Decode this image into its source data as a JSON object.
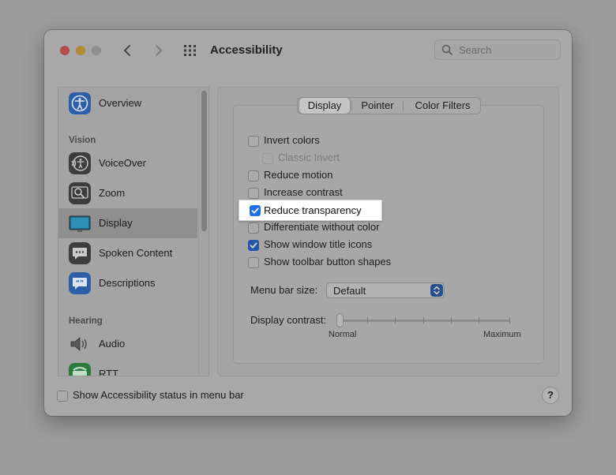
{
  "window": {
    "title": "Accessibility",
    "search_placeholder": "Search"
  },
  "sidebar": {
    "items": [
      {
        "label": "Overview",
        "icon": "overview-icon"
      },
      {
        "label": "VoiceOver",
        "icon": "voiceover-icon"
      },
      {
        "label": "Zoom",
        "icon": "zoom-icon"
      },
      {
        "label": "Display",
        "icon": "display-icon",
        "selected": true
      },
      {
        "label": "Spoken Content",
        "icon": "spoken-content-icon"
      },
      {
        "label": "Descriptions",
        "icon": "descriptions-icon"
      },
      {
        "label": "Audio",
        "icon": "audio-icon"
      },
      {
        "label": "RTT",
        "icon": "rtt-icon"
      }
    ],
    "sections": {
      "vision": "Vision",
      "hearing": "Hearing"
    }
  },
  "tabs": [
    {
      "label": "Display",
      "active": true
    },
    {
      "label": "Pointer",
      "active": false
    },
    {
      "label": "Color Filters",
      "active": false
    }
  ],
  "options": [
    {
      "label": "Invert colors",
      "checked": false,
      "disabled": false
    },
    {
      "label": "Classic Invert",
      "checked": false,
      "disabled": true
    },
    {
      "label": "Reduce motion",
      "checked": false,
      "disabled": false
    },
    {
      "label": "Increase contrast",
      "checked": false,
      "disabled": false
    },
    {
      "label": "Reduce transparency",
      "checked": true,
      "disabled": false,
      "highlighted": true
    },
    {
      "label": "Differentiate without color",
      "checked": false,
      "disabled": false
    },
    {
      "label": "Show window title icons",
      "checked": true,
      "disabled": false
    },
    {
      "label": "Show toolbar button shapes",
      "checked": false,
      "disabled": false
    }
  ],
  "menu_bar_size": {
    "label": "Menu bar size:",
    "value": "Default"
  },
  "display_contrast": {
    "label": "Display contrast:",
    "min_label": "Normal",
    "max_label": "Maximum",
    "value": 0
  },
  "footer": {
    "status_checkbox_label": "Show Accessibility status in menu bar",
    "status_checked": false,
    "help_label": "?"
  },
  "colors": {
    "accent": "#1f6fe5",
    "dimmed_accent": "#2457a8",
    "close": "#b0504a",
    "minimize": "#b48a33"
  }
}
